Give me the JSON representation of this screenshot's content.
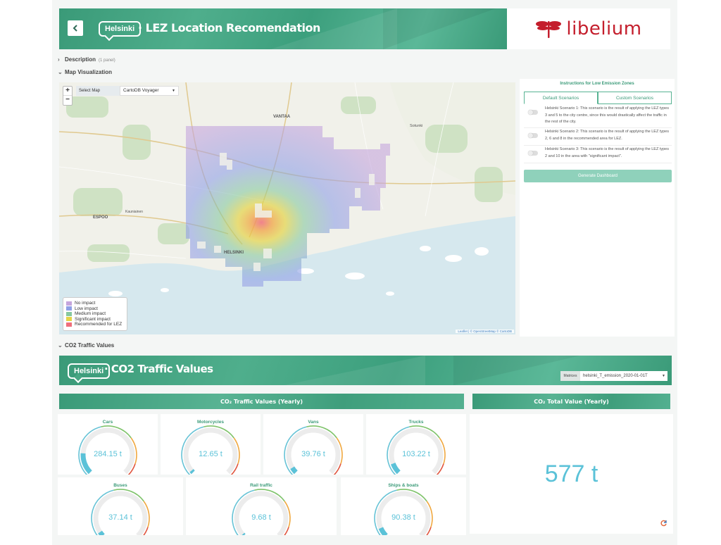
{
  "header": {
    "badge": "Helsinki",
    "title": "· LEZ Location Recomendation",
    "logo_text": "libelium",
    "back_icon": "chevron-left-icon"
  },
  "sections": {
    "description": "Description",
    "description_count": "(1 panel)",
    "map_visualization": "Map Visualization",
    "co2_traffic": "CO2 Traffic Values"
  },
  "map": {
    "zoom_in": "+",
    "zoom_out": "−",
    "select_label": "Select Map",
    "select_value": "CartoDB Voyager",
    "labels": {
      "vantaa": "VANTAA",
      "sotunki": "Sotunki",
      "espoo": "ESPOO",
      "kauniainen": "Kauniainen",
      "helsinki": "HELSINKI"
    },
    "attribution": "Leaflet | © OpenStreetMap © CartoDB",
    "legend": [
      {
        "label": "No impact",
        "color": "#c5a5dd"
      },
      {
        "label": "Low impact",
        "color": "#8fa0e6"
      },
      {
        "label": "Medium impact",
        "color": "#86c89f"
      },
      {
        "label": "Significant impact",
        "color": "#e4d447"
      },
      {
        "label": "Recommended for LEZ",
        "color": "#ef6f7c"
      }
    ]
  },
  "instructions": {
    "title": "Instructions for Low Emission Zones",
    "tab_default": "Default Scenarios",
    "tab_custom": "Custom Scenarios",
    "scenarios": [
      "Helsinki Scenario 1: This scenario is the result of applying the LEZ types 3 and 5 to the city centre, since this would drastically affect the traffic in the rest of the city.",
      "Helsinki Scenario 2: This scenario is the result of applying the LEZ types 2, 6 and 8 in the recommended area for LEZ.",
      "Helsinki Scenario 3: This scenario is the result of applying the LEZ types 2 and 10 in the area with \"significant impact\"."
    ],
    "generate_button": "Generate Dashboard"
  },
  "co2": {
    "badge": "Helsinki",
    "title": "· CO2 Traffic Values",
    "select_label": "Matrices",
    "select_value": "helsinki_T_emission_2020-01-01T",
    "traffic_header": "CO₂ Traffic Values (Yearly)",
    "total_header": "CO₂ Total Value (Yearly)",
    "total_value": "577 t",
    "gauges": [
      {
        "title": "Cars",
        "value": "284.15 t",
        "fraction": 0.18
      },
      {
        "title": "Motorcycles",
        "value": "12.65 t",
        "fraction": 0.02
      },
      {
        "title": "Vans",
        "value": "39.76 t",
        "fraction": 0.05
      },
      {
        "title": "Trucks",
        "value": "103.22 t",
        "fraction": 0.09
      },
      {
        "title": "Buses",
        "value": "37.14 t",
        "fraction": 0.04
      },
      {
        "title": "Rail traffic",
        "value": "9.68 t",
        "fraction": 0.015
      },
      {
        "title": "Ships & boats",
        "value": "90.38 t",
        "fraction": 0.08
      }
    ]
  },
  "colors": {
    "brand_green": "#3a9a78",
    "value_blue": "#5bc2d8",
    "logo_red": "#c41e2c"
  }
}
